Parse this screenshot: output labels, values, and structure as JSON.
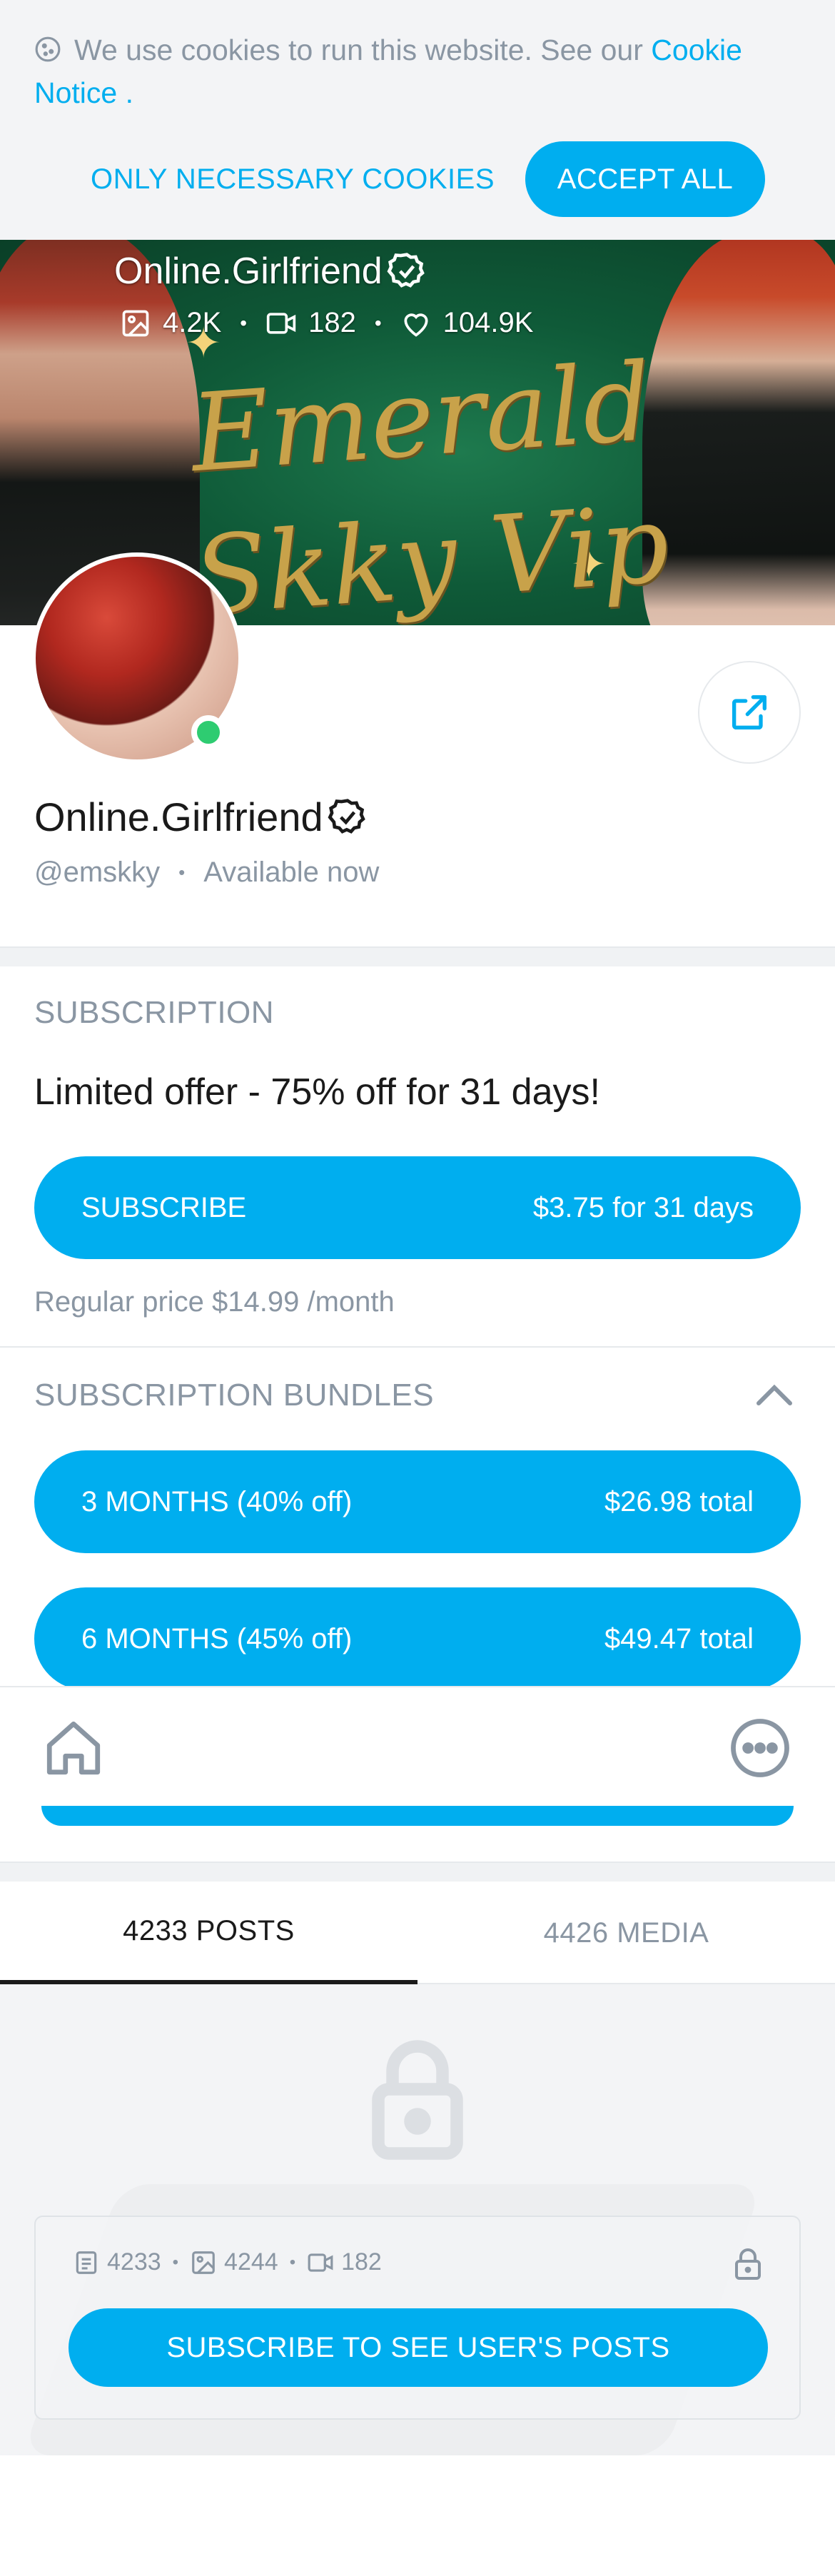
{
  "colors": {
    "accent": "#00aeef",
    "muted": "#8a96a3",
    "online": "#2ecc71"
  },
  "cookie": {
    "text": "We use cookies to run this website. See our",
    "link": "Cookie Notice",
    "suffix": " .",
    "only_necessary": "ONLY NECESSARY COOKIES",
    "accept_all": "ACCEPT ALL"
  },
  "banner": {
    "name": "Online.Girlfriend",
    "photos": "4.2K",
    "videos": "182",
    "likes": "104.9K",
    "script_text": "Emerald Skky Vip"
  },
  "profile": {
    "name": "Online.Girlfriend",
    "handle": "@emskky",
    "status": "Available now"
  },
  "subscription": {
    "label": "SUBSCRIPTION",
    "offer": "Limited offer - 75% off for 31 days!",
    "subscribe_label": "SUBSCRIBE",
    "subscribe_price": "$3.75 for 31 days",
    "regular": "Regular price $14.99 /month"
  },
  "bundles": {
    "label": "SUBSCRIPTION BUNDLES",
    "items": [
      {
        "label": "3 MONTHS (40% off)",
        "price": "$26.98 total"
      },
      {
        "label": "6 MONTHS (45% off)",
        "price": "$49.47 total"
      }
    ]
  },
  "tabs": [
    {
      "label": "4233 POSTS"
    },
    {
      "label": "4426 MEDIA"
    }
  ],
  "locked": {
    "posts": "4233",
    "photos": "4244",
    "videos": "182",
    "button": "SUBSCRIBE TO SEE USER'S POSTS"
  },
  "icons": [
    "cookie-icon",
    "image-icon",
    "video-icon",
    "heart-icon",
    "verified-icon",
    "share-icon",
    "chevron-up-icon",
    "home-icon",
    "more-icon",
    "lock-icon",
    "post-icon"
  ]
}
